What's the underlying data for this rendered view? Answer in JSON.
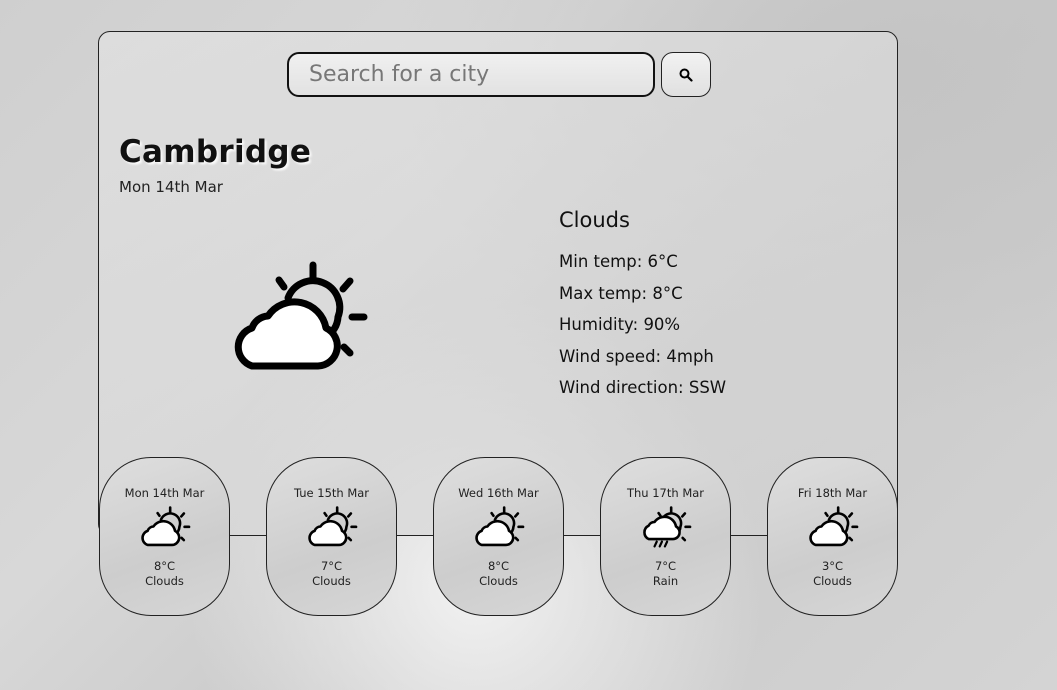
{
  "search": {
    "placeholder": "Search for a city",
    "button_icon": "search-icon"
  },
  "current": {
    "city": "Cambridge",
    "date": "Mon 14th Mar",
    "icon": "cloud-sun-icon",
    "condition": "Clouds",
    "details": [
      {
        "label": "Min temp:",
        "value": "6°C"
      },
      {
        "label": "Max temp:",
        "value": "8°C"
      },
      {
        "label": "Humidity:",
        "value": "90%"
      },
      {
        "label": "Wind speed:",
        "value": "4mph"
      },
      {
        "label": "Wind direction:",
        "value": "SSW"
      }
    ]
  },
  "forecast": [
    {
      "date": "Mon 14th Mar",
      "temp": "8°C",
      "condition": "Clouds",
      "icon": "cloud-sun-icon"
    },
    {
      "date": "Tue 15th Mar",
      "temp": "7°C",
      "condition": "Clouds",
      "icon": "cloud-sun-icon"
    },
    {
      "date": "Wed 16th Mar",
      "temp": "8°C",
      "condition": "Clouds",
      "icon": "cloud-sun-icon"
    },
    {
      "date": "Thu 17th Mar",
      "temp": "7°C",
      "condition": "Rain",
      "icon": "cloud-rain-sun-icon"
    },
    {
      "date": "Fri 18th Mar",
      "temp": "3°C",
      "condition": "Clouds",
      "icon": "cloud-sun-icon"
    }
  ]
}
